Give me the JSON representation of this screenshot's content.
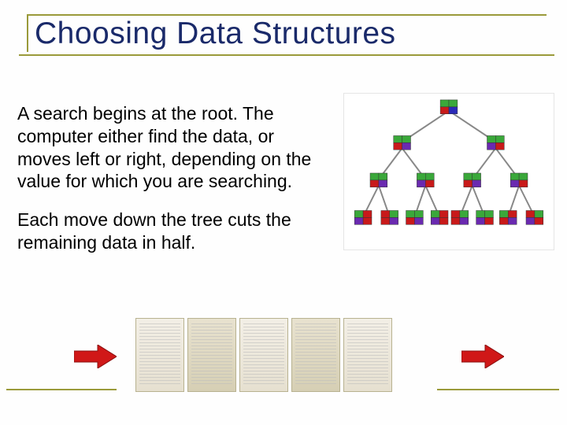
{
  "title": "Choosing Data Structures",
  "paragraph1": "A search begins at the root. The computer either find the data, or moves left or right, depending on the value for which you are searching.",
  "paragraph2": "Each move down the tree cuts the remaining data in half.",
  "tree": {
    "description": "binary-tree-diagram",
    "levels": 4
  },
  "documents": {
    "count": 5
  },
  "arrows": {
    "left": "right-arrow-icon",
    "right": "right-arrow-icon"
  }
}
